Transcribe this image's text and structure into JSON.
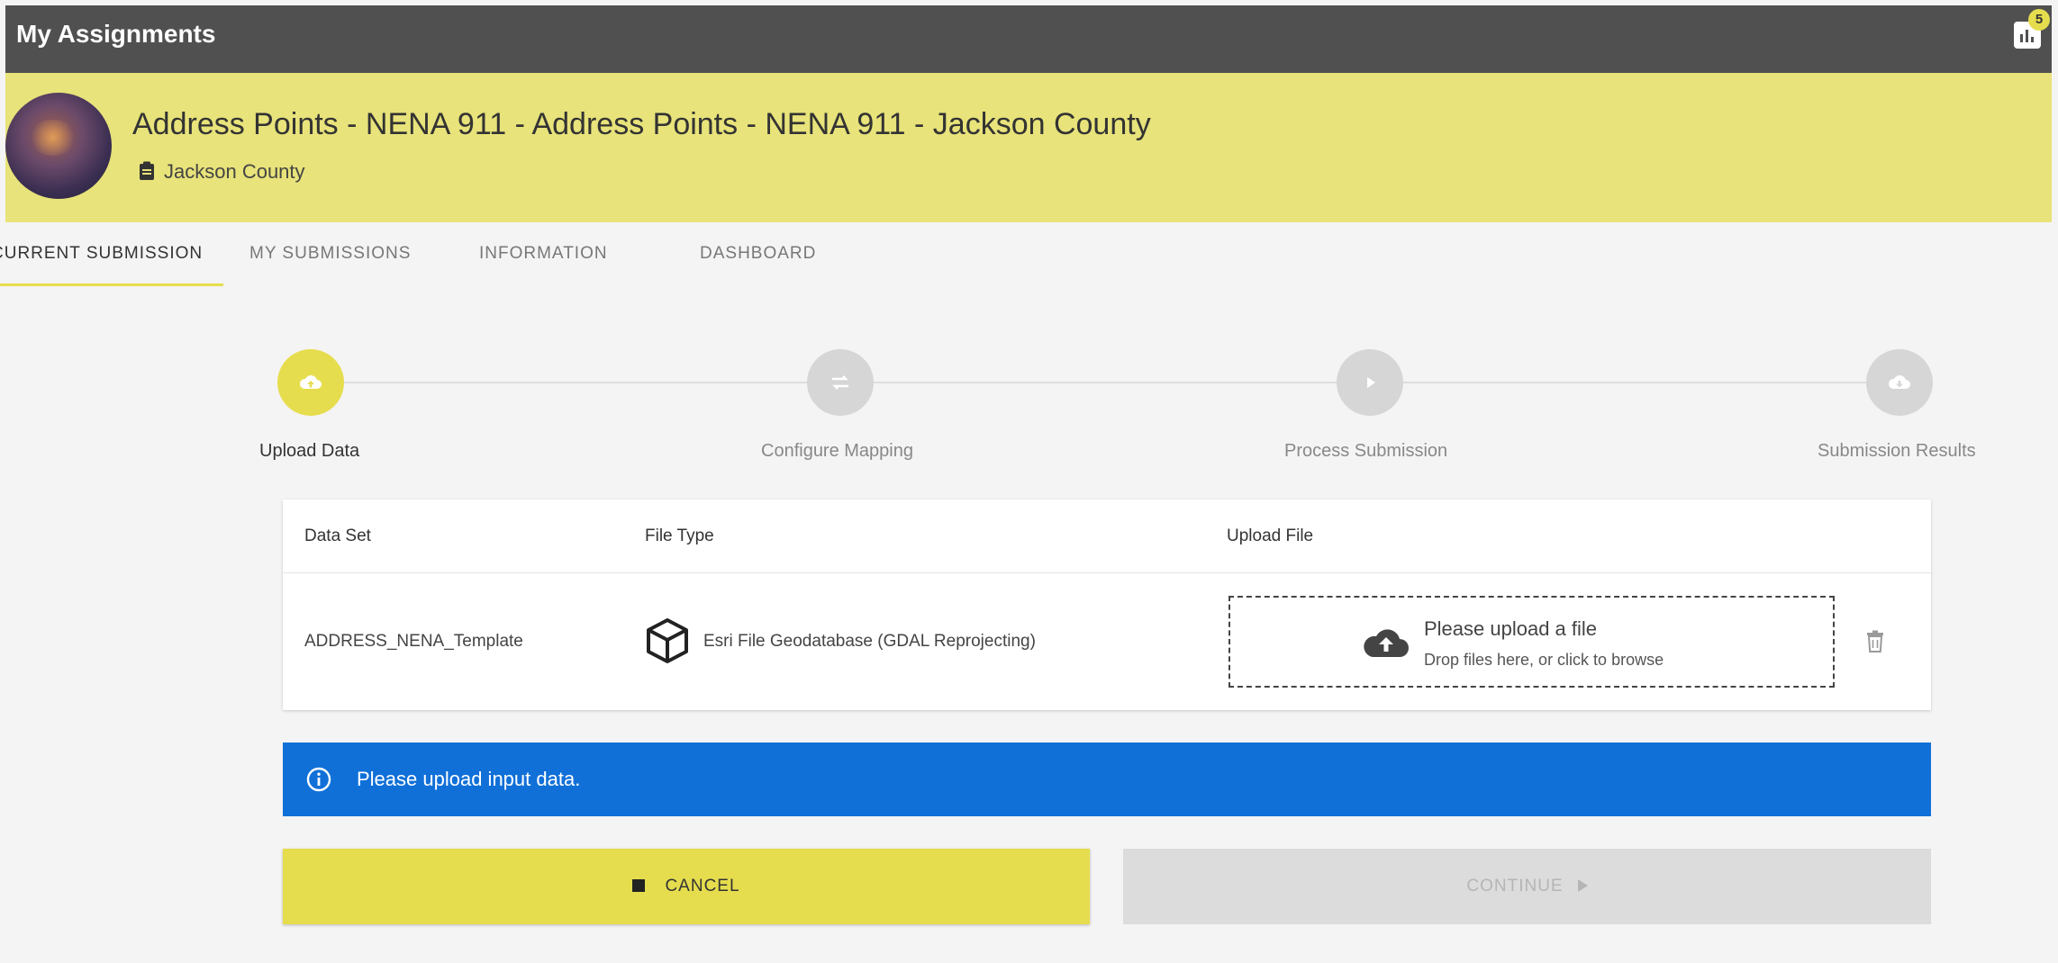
{
  "topbar": {
    "title": "My Assignments",
    "badge_count": "5",
    "chart_icon": "bar-chart-icon"
  },
  "header": {
    "title": "Address Points - NENA 911 - Address Points - NENA 911 - Jackson County",
    "subtitle": "Jackson County",
    "subtitle_icon": "clipboard-icon"
  },
  "tabs": [
    {
      "label": "CURRENT SUBMISSION",
      "active": true
    },
    {
      "label": "MY SUBMISSIONS",
      "active": false
    },
    {
      "label": "INFORMATION",
      "active": false
    },
    {
      "label": "DASHBOARD",
      "active": false
    }
  ],
  "stepper": {
    "steps": [
      {
        "label": "Upload Data",
        "icon": "cloud-upload-icon",
        "active": true
      },
      {
        "label": "Configure Mapping",
        "icon": "swap-arrows-icon",
        "active": false
      },
      {
        "label": "Process Submission",
        "icon": "play-icon",
        "active": false
      },
      {
        "label": "Submission Results",
        "icon": "cloud-download-icon",
        "active": false
      }
    ]
  },
  "table": {
    "headers": [
      "Data Set",
      "File Type",
      "Upload File"
    ],
    "rows": [
      {
        "dataset": "ADDRESS_NENA_Template",
        "file_type": "Esri File Geodatabase (GDAL Reprojecting)",
        "file_type_icon": "cube-icon",
        "upload_title": "Please upload a file",
        "upload_hint": "Drop files here, or click to browse",
        "upload_icon": "cloud-upload-icon",
        "delete_icon": "trash-icon"
      }
    ]
  },
  "banner": {
    "text": "Please upload input data.",
    "icon": "info-icon",
    "color": "#1070d8"
  },
  "buttons": {
    "cancel_label": "CANCEL",
    "continue_label": "CONTINUE"
  },
  "colors": {
    "accent": "#e6dd4e",
    "header_bg": "#e8e37a",
    "topbar_bg": "#505050"
  }
}
